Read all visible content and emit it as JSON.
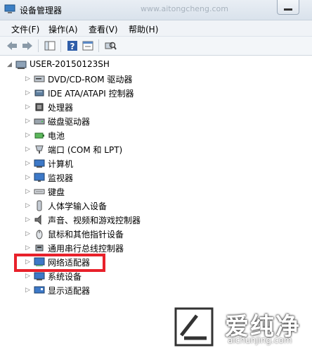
{
  "window": {
    "title": "设备管理器",
    "watermark_url": "www.aitongcheng.com"
  },
  "menu": [
    {
      "label": "文件(F)"
    },
    {
      "label": "操作(A)"
    },
    {
      "label": "查看(V)"
    },
    {
      "label": "帮助(H)"
    }
  ],
  "tree": {
    "root": "USER-20150123SH",
    "items": [
      {
        "label": "DVD/CD-ROM 驱动器",
        "icon": "dvd-drive-icon"
      },
      {
        "label": "IDE ATA/ATAPI 控制器",
        "icon": "ide-controller-icon"
      },
      {
        "label": "处理器",
        "icon": "processor-icon"
      },
      {
        "label": "磁盘驱动器",
        "icon": "disk-drive-icon"
      },
      {
        "label": "电池",
        "icon": "battery-icon"
      },
      {
        "label": "端口 (COM 和 LPT)",
        "icon": "port-icon"
      },
      {
        "label": "计算机",
        "icon": "computer-icon"
      },
      {
        "label": "监视器",
        "icon": "monitor-icon"
      },
      {
        "label": "键盘",
        "icon": "keyboard-icon"
      },
      {
        "label": "人体学输入设备",
        "icon": "hid-icon"
      },
      {
        "label": "声音、视频和游戏控制器",
        "icon": "sound-icon"
      },
      {
        "label": "鼠标和其他指针设备",
        "icon": "mouse-icon"
      },
      {
        "label": "通用串行总线控制器",
        "icon": "usb-icon"
      },
      {
        "label": "网络适配器",
        "icon": "network-adapter-icon"
      },
      {
        "label": "系统设备",
        "icon": "system-device-icon"
      },
      {
        "label": "显示适配器",
        "icon": "display-adapter-icon"
      }
    ]
  },
  "highlight": {
    "color": "#e8212b",
    "target": "网络适配器"
  },
  "logo": {
    "name": "爱纯净",
    "url": "aichunjing.com"
  }
}
